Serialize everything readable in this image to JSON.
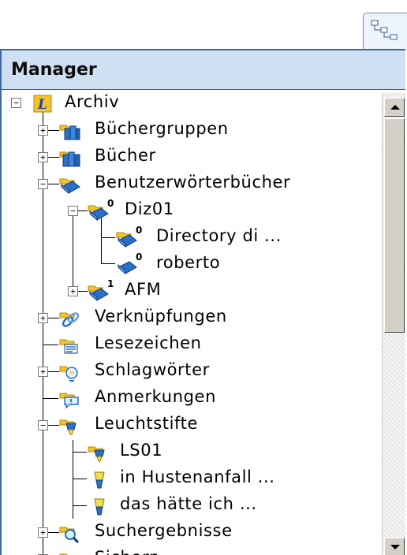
{
  "panel": {
    "title": "Manager"
  },
  "tab": {
    "icon": "tree-view-icon"
  },
  "tree": {
    "items": [
      {
        "label": "Archiv",
        "icon": "archive-icon",
        "badge": ""
      },
      {
        "label": "Büchergruppen",
        "icon": "book-groups-icon",
        "badge": ""
      },
      {
        "label": "Bücher",
        "icon": "books-icon",
        "badge": ""
      },
      {
        "label": "Benutzerwörterbücher",
        "icon": "user-dictionaries-icon",
        "badge": ""
      },
      {
        "label": "Diz01",
        "icon": "dictionary-icon",
        "badge": "0"
      },
      {
        "label": "Directory di ...",
        "icon": "dictionary-icon",
        "badge": "0"
      },
      {
        "label": "roberto",
        "icon": "dictionary-book-icon",
        "badge": "0"
      },
      {
        "label": "AFM",
        "icon": "dictionary-icon",
        "badge": "1"
      },
      {
        "label": "Verknüpfungen",
        "icon": "links-icon",
        "badge": ""
      },
      {
        "label": "Lesezeichen",
        "icon": "bookmarks-icon",
        "badge": ""
      },
      {
        "label": "Schlagwörter",
        "icon": "keywords-icon",
        "badge": ""
      },
      {
        "label": "Anmerkungen",
        "icon": "annotations-icon",
        "badge": ""
      },
      {
        "label": "Leuchtstifte",
        "icon": "highlighters-icon",
        "badge": ""
      },
      {
        "label": "LS01",
        "icon": "highlighter-icon",
        "badge": ""
      },
      {
        "label": "in Hustenanfall ...",
        "icon": "highlighter-icon",
        "badge": ""
      },
      {
        "label": "das hätte ich ...",
        "icon": "highlighter-icon",
        "badge": ""
      },
      {
        "label": "Suchergebnisse",
        "icon": "search-results-icon",
        "badge": ""
      },
      {
        "label": "Sichern",
        "icon": "save-folder-icon",
        "badge": ""
      }
    ]
  },
  "colors": {
    "header_bg": "#cfe0f2",
    "border": "#3d6a99",
    "folder": "#f4c430",
    "book": "#2a6fc9"
  }
}
